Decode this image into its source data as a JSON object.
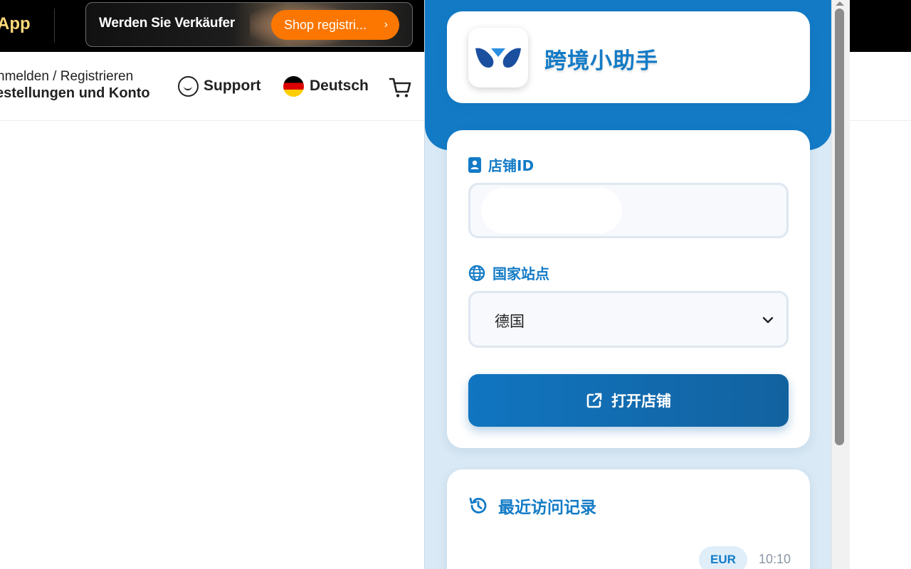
{
  "site": {
    "topbar": {
      "app_text": "App",
      "banner_title": "Werden Sie Verkäufer",
      "banner_button": "Shop registri...",
      "banner_chevron": "›"
    },
    "nav": {
      "account_line1": "nmelden / Registrieren",
      "account_line2": "estellungen und Konto",
      "support": "Support",
      "language": "Deutsch",
      "icons": {
        "support": "chat-smile-icon",
        "language": "germany-flag-icon",
        "cart": "cart-icon"
      }
    }
  },
  "popup": {
    "brand_name": "跨境小助手",
    "store_id_label": "店铺ID",
    "store_id_value": "",
    "country_label": "国家站点",
    "country_selected": "德国",
    "open_button": "打开店铺",
    "history_title": "最近访问记录",
    "history": [
      {
        "currency": "EUR",
        "time": "10:10"
      }
    ],
    "colors": {
      "primary": "#137bc6",
      "background": "#d9e9f5",
      "button_start": "#1175c0",
      "button_end": "#12629f",
      "badge_bg": "#dfeef9"
    },
    "icons": {
      "store_id": "id-badge-icon",
      "country": "globe-icon",
      "open": "external-link-icon",
      "history": "history-icon",
      "select": "chevron-down-icon"
    }
  },
  "brand_colors": {
    "topbar": "#000000",
    "orange": "#fb7701",
    "app_text": "#ffd978"
  }
}
